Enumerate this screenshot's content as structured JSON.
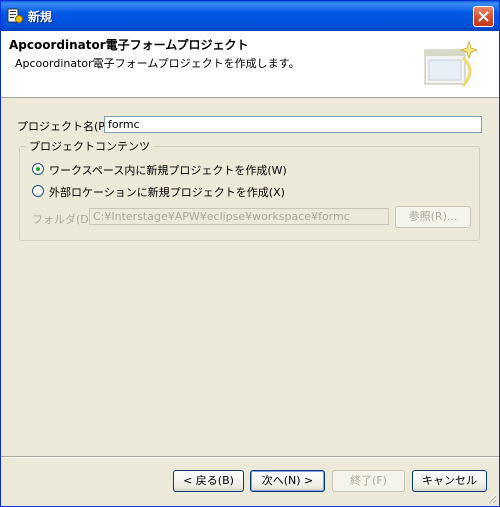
{
  "window": {
    "title": "新規"
  },
  "header": {
    "title": "Apcoordinator電子フォームプロジェクト",
    "description": "Apcoordinator電子フォームプロジェクトを作成します。"
  },
  "form": {
    "project_name_label": "プロジェクト名(P):",
    "project_name_value": "formc",
    "group_title": "プロジェクトコンテンツ",
    "radio_workspace_label": "ワークスペース内に新規プロジェクトを作成(W)",
    "radio_workspace_selected": true,
    "radio_external_label": "外部ロケーションに新規プロジェクトを作成(X)",
    "folder_label": "フォルダ(D):",
    "folder_value": "C:¥Interstage¥APW¥eclipse¥workspace¥formc",
    "browse_label": "参照(R)..."
  },
  "buttons": {
    "back": "< 戻る(B)",
    "next": "次へ(N) >",
    "finish": "終了(F)",
    "cancel": "キャンセル"
  },
  "colors": {
    "titlebar": "#0058e6",
    "dialog_bg": "#ece9d8",
    "radio_dot": "#21a121"
  }
}
